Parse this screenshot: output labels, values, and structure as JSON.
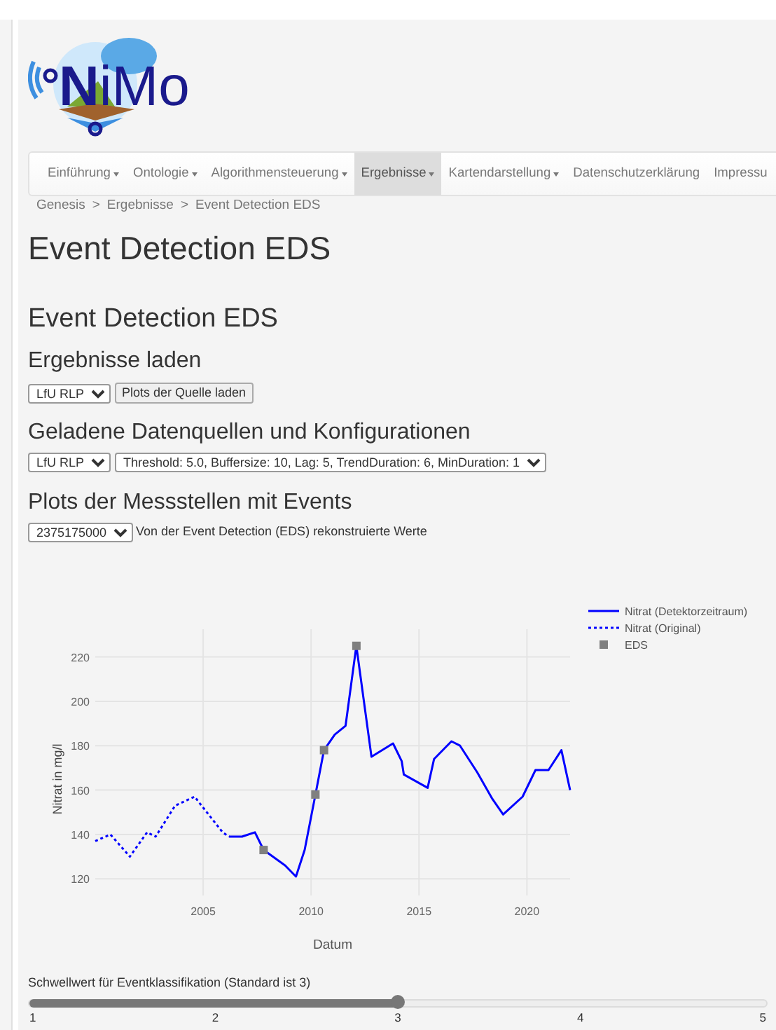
{
  "logo": {
    "text": "**N**iMo"
  },
  "nav": [
    {
      "label": "Einführung",
      "dropdown": true,
      "selected": false
    },
    {
      "label": "Ontologie",
      "dropdown": true,
      "selected": false
    },
    {
      "label": "Algorithmensteuerung",
      "dropdown": true,
      "selected": false
    },
    {
      "label": "Ergebnisse",
      "dropdown": true,
      "selected": true
    },
    {
      "label": "Kartendarstellung",
      "dropdown": true,
      "selected": false
    },
    {
      "label": "Datenschutzerklärung",
      "dropdown": false,
      "selected": false
    },
    {
      "label": "Impressu",
      "dropdown": false,
      "selected": false
    }
  ],
  "breadcrumb": [
    "Genesis",
    "Ergebnisse",
    "Event Detection EDS"
  ],
  "breadcrumb_separator": ">",
  "page_title": "Event Detection EDS",
  "section_title": "Event Detection EDS",
  "load": {
    "heading": "Ergebnisse laden",
    "source": "LfU RLP",
    "button": "Plots der Quelle laden"
  },
  "loaded": {
    "heading": "Geladene Datenquellen und Konfigurationen",
    "source": "LfU RLP",
    "config": "Threshold: 5.0, Buffersize: 10, Lag: 5, TrendDuration: 6, MinDuration: 1"
  },
  "plots": {
    "heading": "Plots der Messstellen mit Events",
    "station": "2375175000",
    "note": "Von der Event Detection (EDS) rekonstruierte Werte",
    "chart_data": {
      "type": "line",
      "grid": true,
      "legend": true,
      "xlabel": "Datum",
      "ylabel": "Nitrat in mg/l",
      "xlim": [
        2000,
        2022
      ],
      "ylim": [
        112.5,
        232.5
      ],
      "xticks": [
        2005,
        2010,
        2015,
        2020
      ],
      "yticks": [
        120,
        140,
        160,
        180,
        200,
        220
      ],
      "x": [
        2000.0,
        2000.7,
        2001.6,
        2002.4,
        2002.8,
        2003.7,
        2004.6,
        2005.9,
        2006.2,
        2006.8,
        2007.4,
        2007.8,
        2008.8,
        2009.3,
        2009.7,
        2010.2,
        2010.6,
        2011.1,
        2011.6,
        2012.1,
        2012.8,
        2013.8,
        2014.2,
        2014.3,
        2015.4,
        2015.7,
        2016.5,
        2016.9,
        2017.7,
        2018.4,
        2018.9,
        2019.8,
        2020.4,
        2021.0,
        2021.6,
        2022.0
      ],
      "series": [
        {
          "name": "Nitrat (Detektorzeitraum)",
          "line_style": "solid",
          "color": "#0000ff",
          "values": [
            null,
            null,
            null,
            null,
            null,
            null,
            null,
            null,
            139,
            139,
            141,
            133,
            126,
            121,
            133,
            158,
            178,
            185,
            189,
            225,
            175,
            181,
            173,
            167,
            161,
            174,
            182,
            180,
            168,
            156,
            149,
            157,
            169,
            169,
            178,
            160
          ]
        },
        {
          "name": "Nitrat (Original)",
          "line_style": "dotted",
          "color": "#0000ff",
          "values": [
            137,
            140,
            130,
            141,
            139,
            153,
            157,
            141,
            139,
            null,
            null,
            null,
            null,
            null,
            null,
            null,
            null,
            null,
            null,
            null,
            null,
            null,
            null,
            null,
            null,
            null,
            null,
            null,
            null,
            null,
            null,
            null,
            null,
            null,
            null,
            null
          ]
        },
        {
          "name": "EDS",
          "type": "scatter",
          "marker": "square",
          "color": "#808080",
          "values": [
            null,
            null,
            null,
            null,
            null,
            null,
            null,
            null,
            null,
            null,
            null,
            133,
            null,
            null,
            null,
            158,
            178,
            null,
            null,
            225,
            null,
            null,
            null,
            null,
            null,
            null,
            null,
            null,
            null,
            null,
            null,
            null,
            null,
            null,
            null,
            null
          ]
        }
      ]
    }
  },
  "slider": {
    "label": "Schwellwert für Eventklassifikation (Standard ist 3)",
    "level": 0.5,
    "ticks": [
      "1",
      "2",
      "3",
      "4",
      "5"
    ]
  }
}
